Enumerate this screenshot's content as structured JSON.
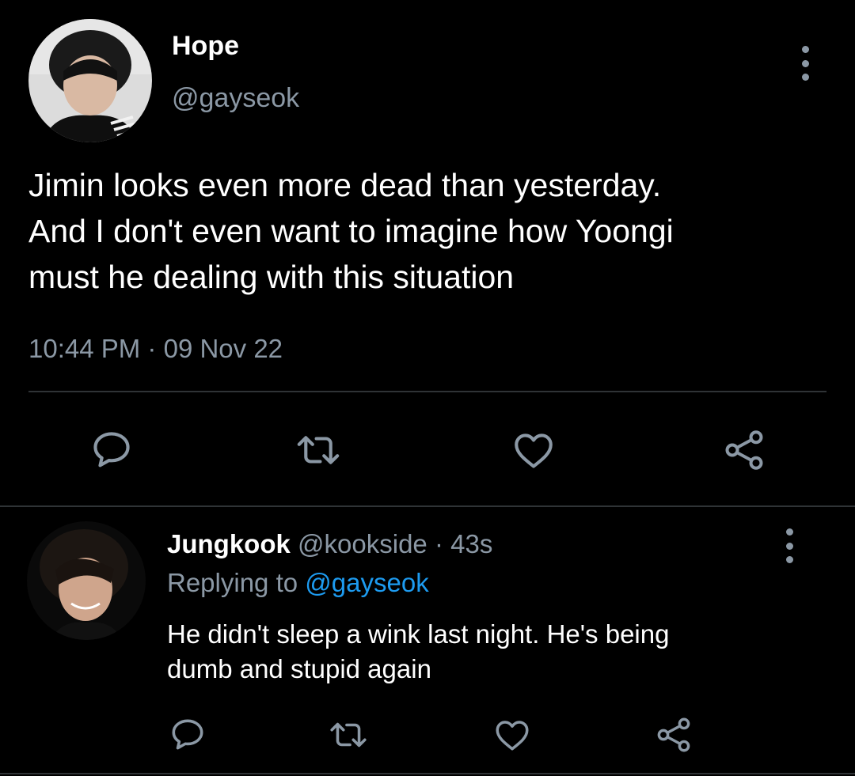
{
  "tweet": {
    "author_name": "Hope",
    "author_handle": "@gayseok",
    "text_lines": [
      "Jimin looks even more dead than yesterday.",
      "And I don't even want to imagine how Yoongi",
      "must he dealing with this situation"
    ],
    "time": "10:44 PM",
    "date_separator": "·",
    "date": "09 Nov 22",
    "actions": [
      "comment-icon",
      "retweet-icon",
      "heart-icon",
      "share-icon"
    ]
  },
  "reply": {
    "author_name": "Jungkook",
    "author_handle": "@kookside",
    "separator": "·",
    "time_ago": "43s",
    "replying_label": "Replying to",
    "replying_mention": "@gayseok",
    "text_lines": [
      "He didn't sleep a wink last night. He's being",
      "dumb and stupid again"
    ],
    "actions": [
      "comment-icon",
      "retweet-icon",
      "heart-icon",
      "share-icon"
    ]
  },
  "colors": {
    "background": "#000000",
    "primary_text": "#ffffff",
    "secondary_text": "#8b98a5",
    "mention": "#1d9bf0",
    "divider": "#2f3336",
    "icon": "#8b98a5"
  }
}
